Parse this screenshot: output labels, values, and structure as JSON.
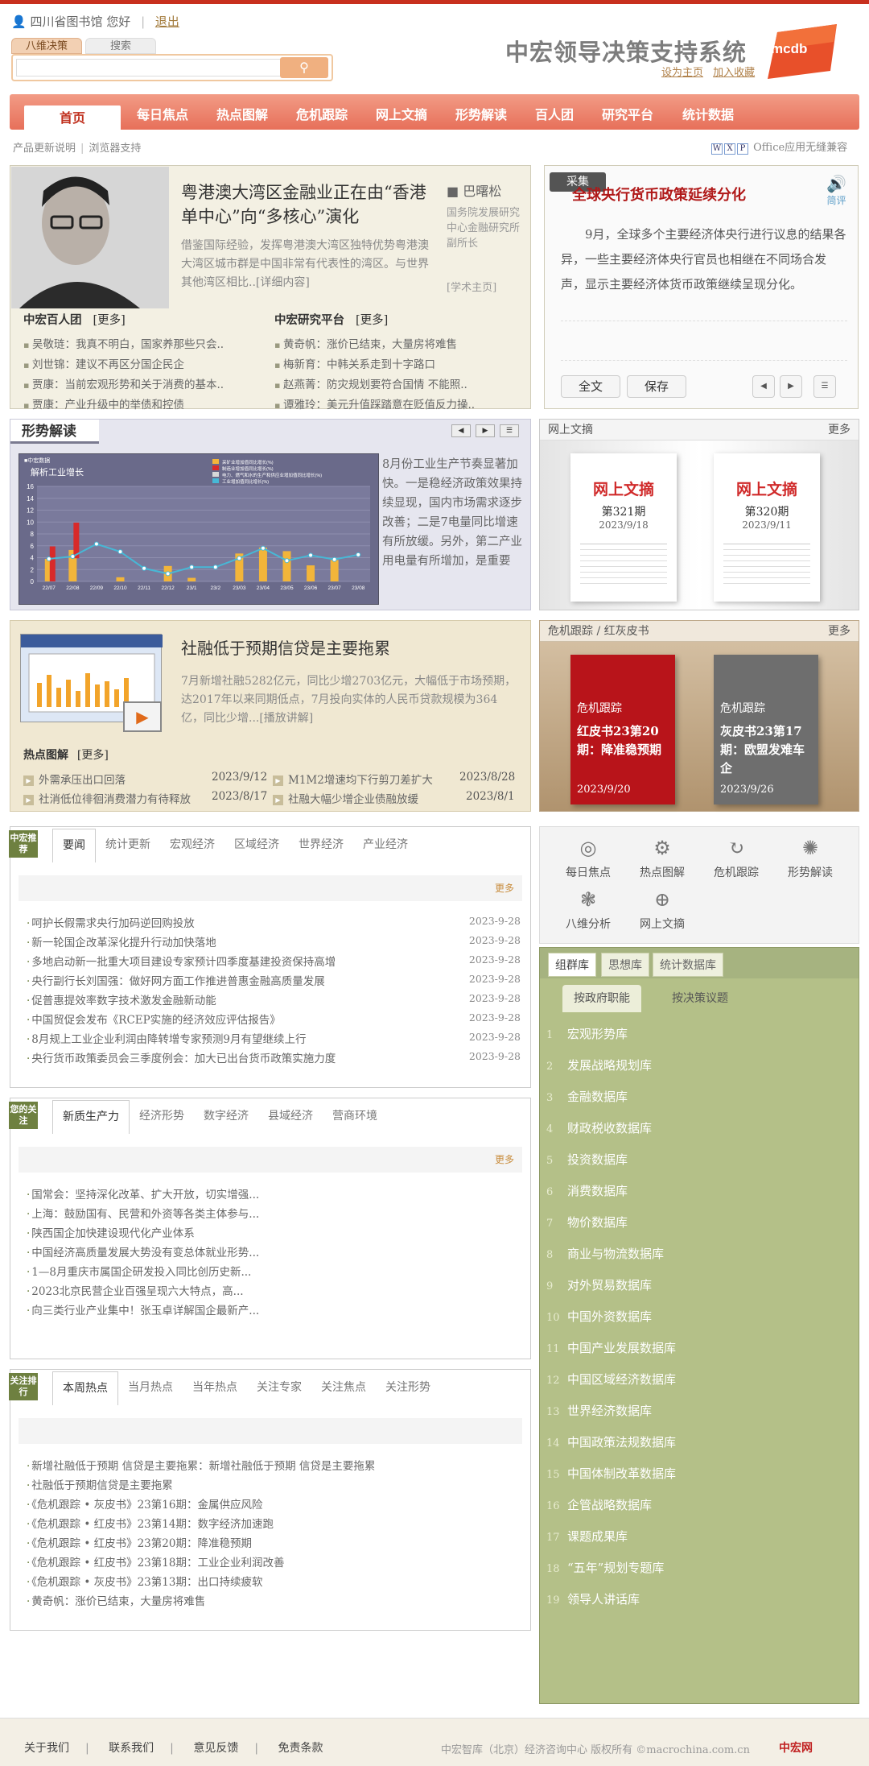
{
  "header": {
    "user_org": "四川省图书馆",
    "greeting": "您好",
    "logout": "退出",
    "tab_bawei": "八维决策",
    "tab_search": "搜索",
    "system_title": "中宏领导决策支持系统",
    "set_home": "设为主页",
    "add_fav": "加入收藏",
    "logo_text": "mcdb"
  },
  "nav": [
    "首页",
    "每日焦点",
    "热点图解",
    "危机跟踪",
    "网上文摘",
    "形势解读",
    "百人团",
    "研究平台",
    "统计数据"
  ],
  "subbar": {
    "update_note": "产品更新说明",
    "browser": "浏览器支持",
    "office": "Office应用无缝兼容"
  },
  "feature": {
    "headline": "粤港澳大湾区金融业正在由“香港单中心”向“多核心”演化",
    "body": "借鉴国际经验，发挥粤港澳大湾区独特优势粤港澳大湾区城市群是中国非常有代表性的湾区。与世界其他湾区相比..[详细内容]",
    "author_name": "巴曙松",
    "author_title": "国务院发展研究中心金融研究所副所长",
    "homepage": "[学术主页]",
    "left_list_title": "中宏百人团",
    "left_more": "[更多]",
    "left_items": [
      "吴敬琏：我真不明白，国家养那些只会..",
      "刘世锦：建议不再区分国企民企",
      "贾康：当前宏观形势和关于消费的基本..",
      "贾康：产业升级中的举债和控债"
    ],
    "right_list_title": "中宏研究平台",
    "right_more": "[更多]",
    "right_items": [
      "黄奇帆：涨价已结束，大量房将难售",
      "梅新育：中韩关系走到十字路口",
      "赵燕菁：防灾规划要符合国情 不能照..",
      "谭雅玲：美元升值踩踏意在贬值反力操.."
    ]
  },
  "focus_news": {
    "tag": "采集",
    "headline": "全球央行货币政策延续分化",
    "body": "9月，全球多个主要经济体央行进行议息的结果各异，一些主要经济体央行官员也相继在不同场合发声，显示主要经济体货币政策继续呈现分化。",
    "brief": "简评",
    "btn_full": "全文",
    "btn_save": "保存"
  },
  "situation": {
    "title": "形势解读",
    "chart_title": "解析工业增长",
    "chart_source": "中宏数据",
    "text": "8月份工业生产节奏显著加快。一是稳经济政策效果持续显现，国内市场需求逐步改善；二是7电量同比增速有所放缓。另外，第二产业用电量有所增加，是重要"
  },
  "chart_data": {
    "type": "bar",
    "title": "解析工业增长",
    "categories": [
      "22/07",
      "22/08",
      "22/09",
      "22/10",
      "22/11",
      "22/12",
      "23/1",
      "23/2",
      "23/03",
      "23/04",
      "23/05",
      "23/06",
      "23/07",
      "23/08"
    ],
    "series": [
      {
        "name": "采矿业增加值同比增长(%)",
        "values": [
          3.8,
          5.3,
          0,
          0.7,
          0,
          2.6,
          0.6,
          0,
          4.7,
          5.7,
          5.1,
          2.7,
          3.6,
          0
        ]
      },
      {
        "name": "制造业增加值同比增长(%)",
        "values": [
          5.9,
          9.9,
          0,
          0,
          0,
          0,
          0,
          0,
          0,
          0,
          0,
          0,
          0,
          0
        ]
      },
      {
        "name": "电力、燃气和水的生产和供应业增加值同比增长(%)",
        "values": [
          0,
          0,
          0,
          0,
          0,
          0,
          0,
          0,
          0,
          0,
          0,
          0,
          0,
          0
        ]
      },
      {
        "name": "工业增加值同比增长(%)",
        "values": [
          3.8,
          4.2,
          6.3,
          5.0,
          2.2,
          1.3,
          2.4,
          2.4,
          3.9,
          5.6,
          3.5,
          4.4,
          3.7,
          4.5
        ]
      }
    ],
    "ylim": [
      0,
      16
    ],
    "yticks": [
      "0",
      "2",
      "4",
      "6",
      "8",
      "10",
      "12",
      "14",
      "16"
    ],
    "colors": {
      "bar": "#f2b53a",
      "bar_red": "#d82a2a",
      "line": "#47b8d6",
      "bg": "#6a6a8a"
    }
  },
  "wenzhai": {
    "title": "网上文摘",
    "more": "更多",
    "books": [
      {
        "name": "网上文摘",
        "issue": "第321期",
        "date": "2023/9/18"
      },
      {
        "name": "网上文摘",
        "issue": "第320期",
        "date": "2023/9/11"
      }
    ]
  },
  "crisis": {
    "title": "危机跟踪 / 红灰皮书",
    "more": "更多",
    "books": [
      {
        "tag": "危机跟踪",
        "title": "红皮书23第20期：降准稳预期",
        "date": "2023/9/20",
        "color": "#b8141a"
      },
      {
        "tag": "危机跟踪",
        "title": "灰皮书23第17期：欧盟发难车企",
        "date": "2023/9/26",
        "color": "#6e6e6e"
      }
    ]
  },
  "hot_img": {
    "headline": "社融低于预期信贷是主要拖累",
    "body": "7月新增社融5282亿元，同比少增2703亿元，大幅低于市场预期，达2017年以来同期低点，7月投向实体的人民币贷款规模为364亿，同比少增...[播放讲解]",
    "label": "热点图解",
    "more": "[更多]",
    "items": [
      {
        "t": "外需承压出口回落",
        "d": "2023/9/12"
      },
      {
        "t": "M1M2增速均下行剪刀差扩大",
        "d": "2023/8/28"
      },
      {
        "t": "社消低位徘徊消费潜力有待释放",
        "d": "2023/8/17"
      },
      {
        "t": "社融大幅少增企业债融放缓",
        "d": "2023/8/1"
      }
    ]
  },
  "recommend": {
    "badge": "中宏推荐",
    "tabs": [
      "要闻",
      "统计更新",
      "宏观经济",
      "区域经济",
      "世界经济",
      "产业经济"
    ],
    "more": "更多",
    "items": [
      {
        "t": "呵护长假需求央行加码逆回购投放",
        "d": "2023-9-28"
      },
      {
        "t": "新一轮国企改革深化提升行动加快落地",
        "d": "2023-9-28"
      },
      {
        "t": "多地启动新一批重大项目建设专家预计四季度基建投资保持高增",
        "d": "2023-9-28"
      },
      {
        "t": "央行副行长刘国强：做好网方面工作推进普惠金融高质量发展",
        "d": "2023-9-28"
      },
      {
        "t": "促普惠提效率数字技术激发金融新动能",
        "d": "2023-9-28"
      },
      {
        "t": "中国贸促会发布《RCEP实施的经济效应评估报告》",
        "d": "2023-9-28"
      },
      {
        "t": "8月规上工业企业利润由降转增专家预测9月有望继续上行",
        "d": "2023-9-28"
      },
      {
        "t": "央行货币政策委员会三季度例会：加大已出台货币政策实施力度",
        "d": "2023-9-28"
      }
    ]
  },
  "attention": {
    "badge": "您的关注",
    "tabs": [
      "新质生产力",
      "经济形势",
      "数字经济",
      "县域经济",
      "营商环境"
    ],
    "more": "更多",
    "items": [
      "国常会：坚持深化改革、扩大开放，切实增强...",
      "上海：鼓励国有、民营和外资等各类主体参与...",
      "陕西国企加快建设现代化产业体系",
      "中国经济高质量发展大势没有变总体就业形势...",
      "1—8月重庆市属国企研发投入同比创历史新...",
      "2023北京民营企业百强呈现六大特点，高...",
      "向三类行业产业集中！张玉卓详解国企最新产..."
    ]
  },
  "ranking": {
    "badge": "关注排行",
    "tabs": [
      "本周热点",
      "当月热点",
      "当年热点",
      "关注专家",
      "关注焦点",
      "关注形势"
    ],
    "items": [
      "新增社融低于预期 信贷是主要拖累：新增社融低于预期 信贷是主要拖累",
      "社融低于预期信贷是主要拖累",
      "《危机跟踪 • 灰皮书》23第16期：金属供应风险",
      "《危机跟踪 • 红皮书》23第14期：数字经济加速跑",
      "《危机跟踪 • 红皮书》23第20期：降准稳预期",
      "《危机跟踪 • 红皮书》23第18期：工业企业利润改善",
      "《危机跟踪 • 灰皮书》23第13期：出口持续疲软",
      "黄奇帆：涨价已结束，大量房将难售"
    ]
  },
  "quick_icons": [
    "每日焦点",
    "热点图解",
    "危机跟踪",
    "形势解读",
    "八维分析",
    "网上文摘"
  ],
  "database": {
    "tabs": [
      "组群库",
      "思想库",
      "统计数据库"
    ],
    "subtabs": [
      "按政府职能",
      "按决策议题"
    ],
    "items": [
      "宏观形势库",
      "发展战略规划库",
      "金融数据库",
      "财政税收数据库",
      "投资数据库",
      "消费数据库",
      "物价数据库",
      "商业与物流数据库",
      "对外贸易数据库",
      "中国外资数据库",
      "中国产业发展数据库",
      "中国区域经济数据库",
      "世界经济数据库",
      "中国政策法规数据库",
      "中国体制改革数据库",
      "企管战略数据库",
      "课题成果库",
      "“五年”规划专题库",
      "领导人讲话库"
    ]
  },
  "footer": {
    "links": [
      "关于我们",
      "联系我们",
      "意见反馈",
      "免责条款"
    ],
    "copyright": "中宏智库（北京）经济咨询中心 版权所有 ©macrochina.com.cn",
    "logo_text": "中宏网"
  }
}
